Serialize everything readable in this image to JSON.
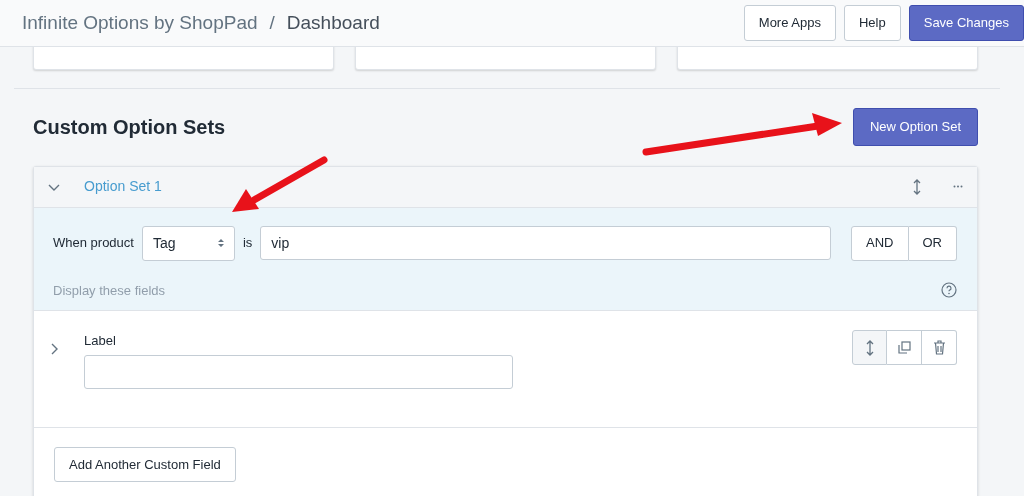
{
  "top_bar": {
    "app_title": "Infinite Options by ShopPad",
    "separator": "/",
    "page_title": "Dashboard",
    "buttons": [
      {
        "label": "More Apps",
        "kind": "secondary"
      },
      {
        "label": "Help",
        "kind": "secondary"
      },
      {
        "label": "Save Changes",
        "kind": "primary"
      }
    ]
  },
  "section": {
    "title": "Custom Option Sets",
    "new_button": "New Option Set"
  },
  "option_set": {
    "title": "Option Set 1",
    "expanded": true,
    "condition": {
      "label": "When product",
      "attribute": "Tag",
      "operator": "is",
      "value": "vip",
      "logic": [
        {
          "label": "AND"
        },
        {
          "label": "OR"
        }
      ],
      "display_label": "Display these fields"
    },
    "fields": [
      {
        "label": "Label",
        "expanded": false
      }
    ],
    "add_button": "Add Another Custom Field"
  }
}
